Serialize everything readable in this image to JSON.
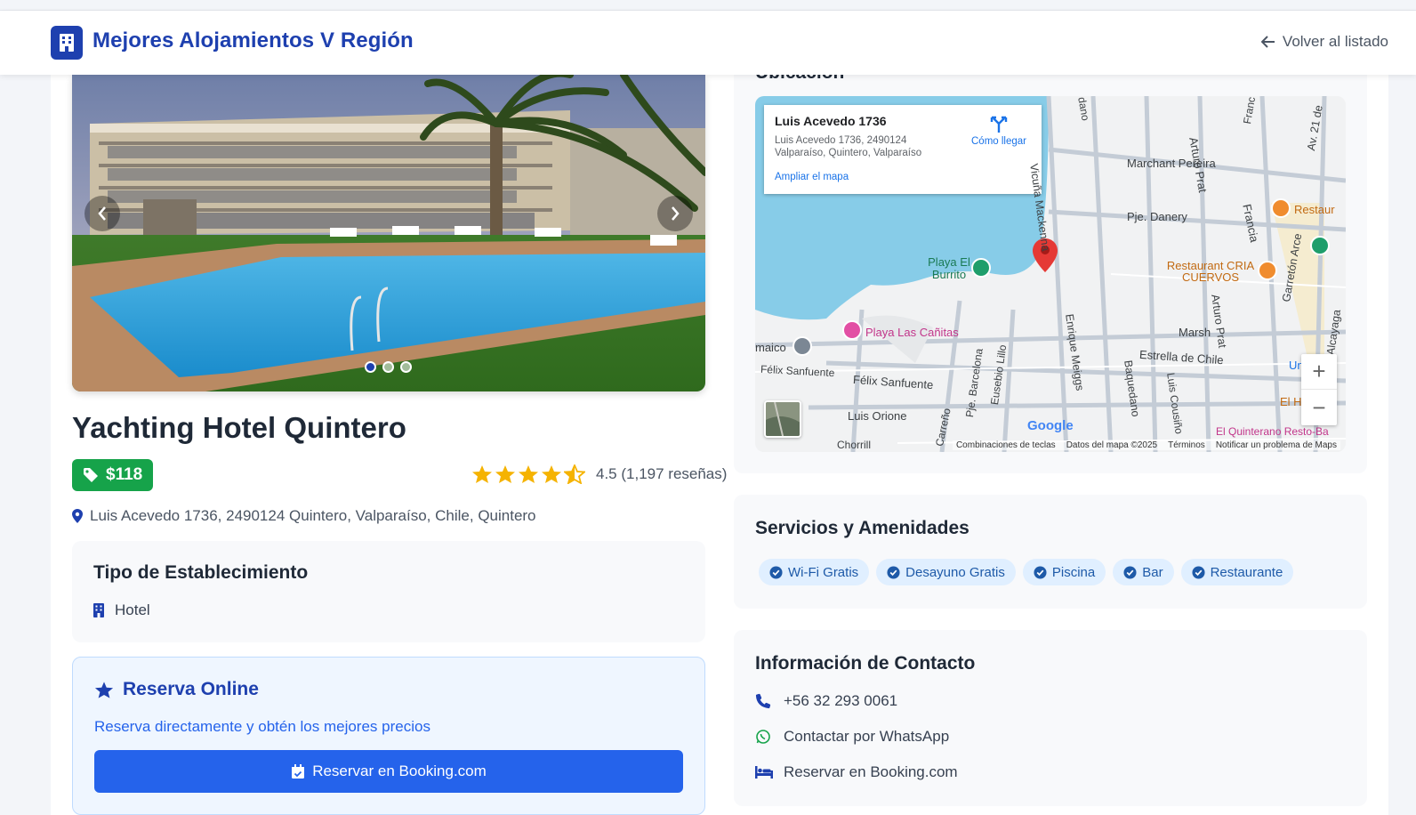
{
  "header": {
    "brand_title": "Mejores Alojamientos V Región",
    "back_label": "Volver al listado"
  },
  "gallery": {
    "slide_count": 3,
    "active_slide": 1
  },
  "hotel": {
    "name": "Yachting Hotel Quintero",
    "price": "$118",
    "rating_value": 4.5,
    "rating_text": "4.5 (1,197 reseñas)",
    "address": "Luis Acevedo 1736, 2490124 Quintero, Valparaíso, Chile, Quintero"
  },
  "tipo": {
    "title": "Tipo de Establecimiento",
    "value": "Hotel"
  },
  "reserva": {
    "title": "Reserva Online",
    "subtitle": "Reserva directamente y obtén los mejores precios",
    "button_label": "Reservar en Booking.com"
  },
  "map": {
    "section_title": "Ubicación",
    "info_title": "Luis Acevedo 1736",
    "info_address": "Luis Acevedo 1736, 2490124 Valparaíso, Quintero, Valparaíso",
    "directions_label": "Cómo llegar",
    "enlarge_label": "Ampliar el mapa",
    "labels": {
      "vicuna": "Vicuña Mackenna",
      "marchant": "Marchant Pereira",
      "pje_danery": "Pje. Danery",
      "arturo_prat": "Arturo Prat",
      "francia": "Francia",
      "restaurant_top": "Restaur",
      "restaurant_cria": "Restaurant CRIA CUERVOS",
      "playa_burrito": "Playa El Burrito",
      "playa_canitas": "Playa Las Cañitas",
      "maico": "maico",
      "felix_left": "Félix Sanfuente",
      "felix": "Félix Sanfuente",
      "luis_orione": "Luis Orione",
      "enrique": "Enrique Meiggs",
      "baquedano": "Baquedano",
      "estrella": "Estrella de Chile",
      "unimarc": "Unimarc",
      "marsh": "Marsh",
      "el_hoyo": "El Hoyo",
      "garreton": "Garretón Arce",
      "alcayaga": "Alcayaga",
      "av21": "Av. 21 de",
      "eusebio": "Eusebio Lillo",
      "pje_barcelona": "Pje. Barcelona",
      "carreno": "Carreño",
      "cousino": "Luis Cousiño",
      "quinterano": "El Quinterano Resto-Ba",
      "chorrillos": "Chorrill",
      "franc": "Franc",
      "dano": "dano",
      "google": "Google"
    },
    "footer": [
      "Combinaciones de teclas",
      "Datos del mapa ©2025",
      "Términos",
      "Notificar un problema de Maps"
    ]
  },
  "servicios": {
    "title": "Servicios y Amenidades",
    "items": [
      "Wi-Fi Gratis",
      "Desayuno Gratis",
      "Piscina",
      "Bar",
      "Restaurante"
    ]
  },
  "contacto": {
    "title": "Información de Contacto",
    "phone": "+56 32 293 0061",
    "whatsapp": "Contactar por WhatsApp",
    "booking": "Reservar en Booking.com"
  },
  "colors": {
    "primary": "#1e40af",
    "accent": "#2563eb",
    "price": "#16a34a",
    "star": "#f5b301"
  }
}
